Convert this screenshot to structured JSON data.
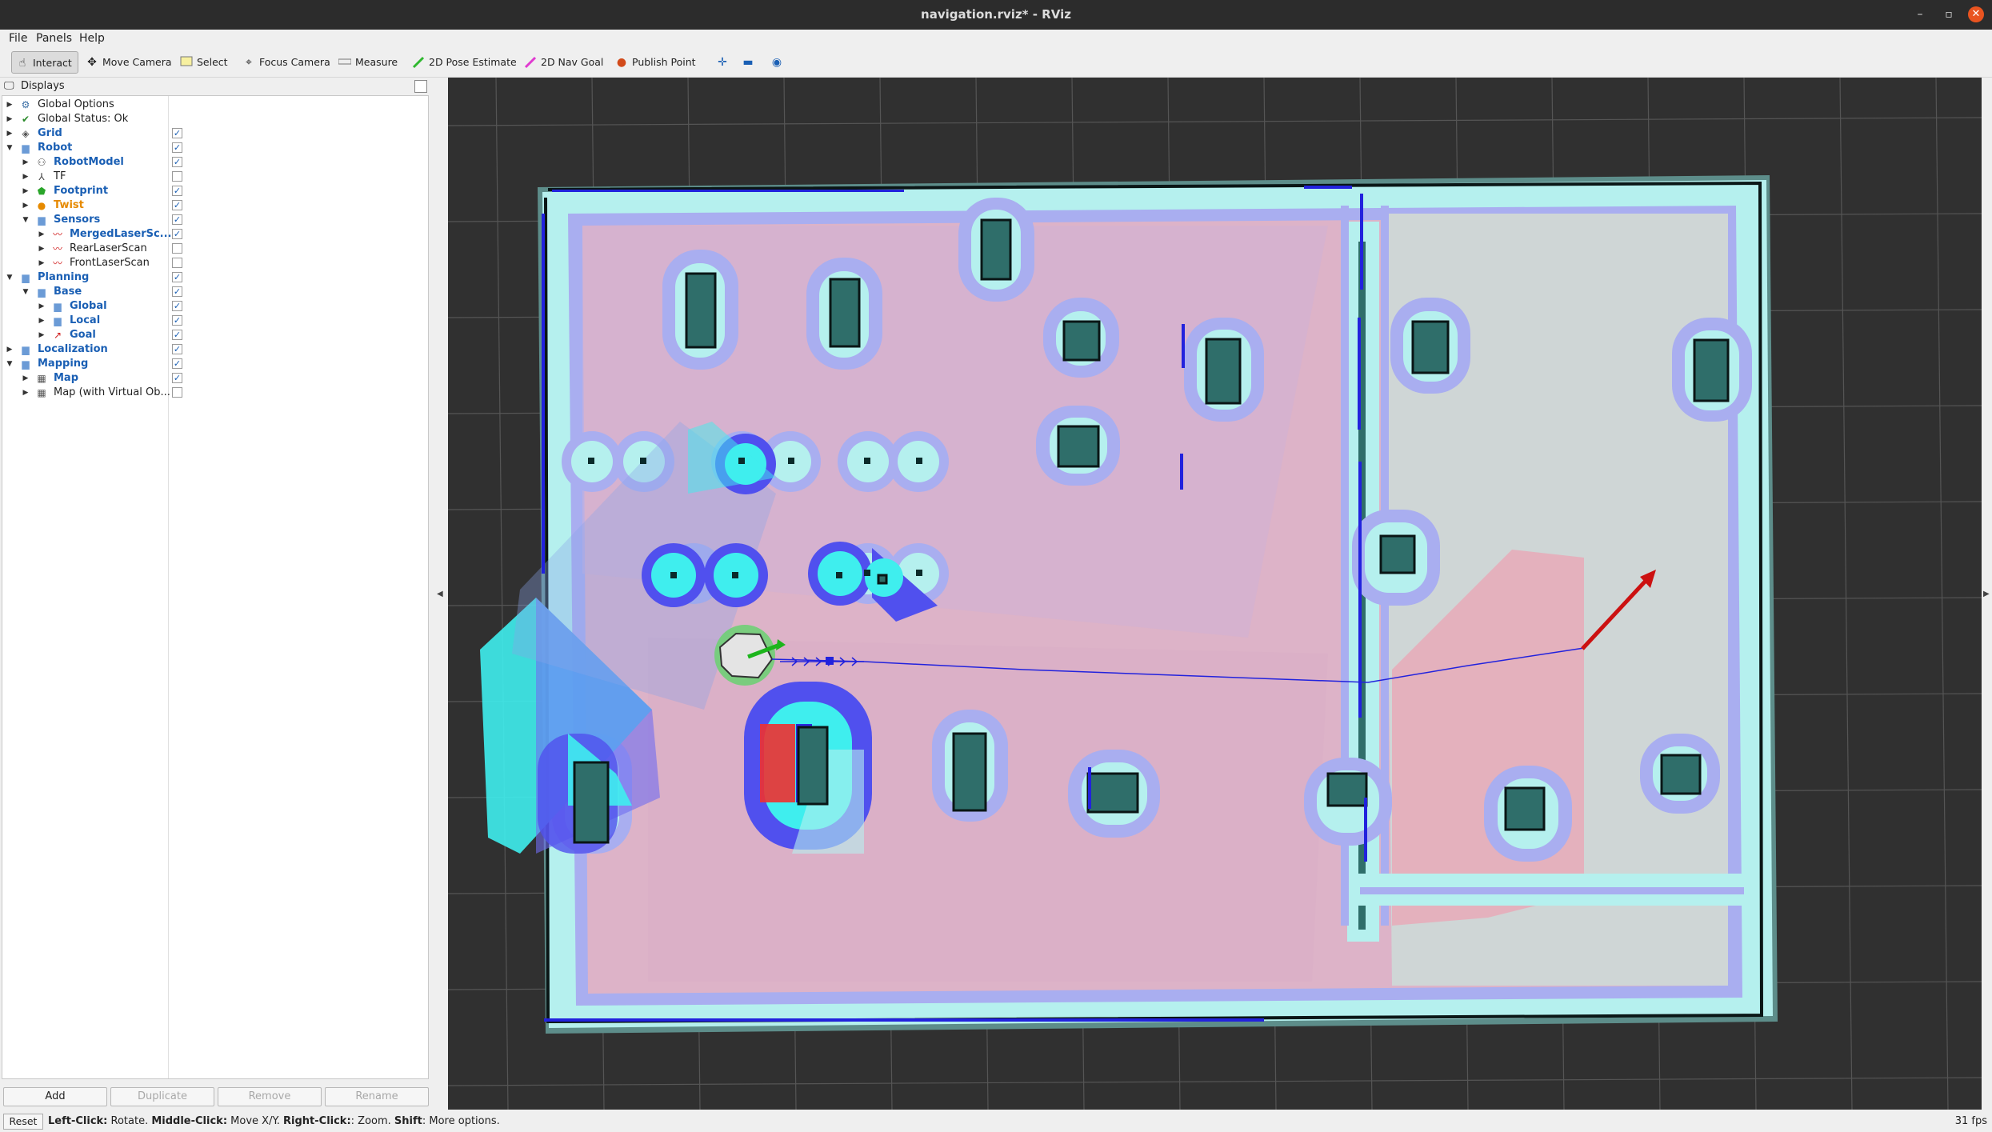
{
  "window": {
    "title": "navigation.rviz* - RViz",
    "controls": {
      "minimize": "–",
      "maximize": "▫",
      "close": "✕"
    }
  },
  "menu": [
    "File",
    "Panels",
    "Help"
  ],
  "toolbar": {
    "tools": [
      {
        "label": "Interact",
        "icon": "hand-icon",
        "active": true
      },
      {
        "label": "Move Camera",
        "icon": "move-camera-icon"
      },
      {
        "label": "Select",
        "icon": "select-icon"
      },
      {
        "label": "Focus Camera",
        "icon": "focus-camera-icon"
      },
      {
        "label": "Measure",
        "icon": "measure-icon"
      },
      {
        "label": "2D Pose Estimate",
        "icon": "pose-estimate-arrow-icon"
      },
      {
        "label": "2D Nav Goal",
        "icon": "nav-goal-arrow-icon"
      },
      {
        "label": "Publish Point",
        "icon": "publish-point-pin-icon"
      }
    ]
  },
  "displays_panel": {
    "title": "Displays",
    "items": [
      {
        "label": "Global Options",
        "icon": "gear-icon",
        "depth": 0,
        "expand": "collapsed",
        "style": "plain",
        "check": null
      },
      {
        "label": "Global Status: Ok",
        "icon": "check-status-icon",
        "depth": 0,
        "expand": "collapsed",
        "style": "plain",
        "check": null
      },
      {
        "label": "Grid",
        "icon": "grid-icon",
        "depth": 0,
        "expand": "collapsed",
        "style": "blue",
        "check": true
      },
      {
        "label": "Robot",
        "icon": "folder-icon",
        "depth": 0,
        "expand": "expanded",
        "style": "blue",
        "check": true
      },
      {
        "label": "RobotModel",
        "icon": "robot-model-icon",
        "depth": 1,
        "expand": "collapsed",
        "style": "blue",
        "check": true
      },
      {
        "label": "TF",
        "icon": "tf-axes-icon",
        "depth": 1,
        "expand": "collapsed",
        "style": "plain",
        "check": false
      },
      {
        "label": "Footprint",
        "icon": "polygon-icon",
        "depth": 1,
        "expand": "collapsed",
        "style": "blue",
        "check": true
      },
      {
        "label": "Twist",
        "icon": "warning-icon",
        "depth": 1,
        "expand": "collapsed",
        "style": "orange",
        "check": true
      },
      {
        "label": "Sensors",
        "icon": "folder-icon",
        "depth": 1,
        "expand": "expanded",
        "style": "blue",
        "check": true
      },
      {
        "label": "MergedLaserSc...",
        "icon": "laser-scan-icon",
        "depth": 2,
        "expand": "collapsed",
        "style": "blue",
        "check": true
      },
      {
        "label": "RearLaserScan",
        "icon": "laser-scan-icon",
        "depth": 2,
        "expand": "collapsed",
        "style": "plain",
        "check": false
      },
      {
        "label": "FrontLaserScan",
        "icon": "laser-scan-icon",
        "depth": 2,
        "expand": "collapsed",
        "style": "plain",
        "check": false
      },
      {
        "label": "Planning",
        "icon": "folder-icon",
        "depth": 0,
        "expand": "expanded",
        "style": "blue",
        "check": true
      },
      {
        "label": "Base",
        "icon": "folder-icon",
        "depth": 1,
        "expand": "expanded",
        "style": "blue",
        "check": true
      },
      {
        "label": "Global",
        "icon": "folder-icon",
        "depth": 2,
        "expand": "collapsed",
        "style": "blue",
        "check": true
      },
      {
        "label": "Local",
        "icon": "folder-icon",
        "depth": 2,
        "expand": "collapsed",
        "style": "blue",
        "check": true
      },
      {
        "label": "Goal",
        "icon": "pose-arrow-icon",
        "depth": 2,
        "expand": "collapsed",
        "style": "blue",
        "check": true
      },
      {
        "label": "Localization",
        "icon": "folder-icon",
        "depth": 0,
        "expand": "collapsed",
        "style": "blue",
        "check": true
      },
      {
        "label": "Mapping",
        "icon": "folder-icon",
        "depth": 0,
        "expand": "expanded",
        "style": "blue",
        "check": true
      },
      {
        "label": "Map",
        "icon": "map-icon",
        "depth": 1,
        "expand": "collapsed",
        "style": "blue",
        "check": true
      },
      {
        "label": "Map (with Virtual Ob...",
        "icon": "map-icon",
        "depth": 1,
        "expand": "collapsed",
        "style": "plain",
        "check": false
      }
    ],
    "buttons": {
      "add": "Add",
      "duplicate": "Duplicate",
      "remove": "Remove",
      "rename": "Rename"
    }
  },
  "status_bar": {
    "reset": "Reset",
    "hint_parts": [
      {
        "text": "Left-Click:",
        "bold": true
      },
      {
        "text": " Rotate. ",
        "bold": false
      },
      {
        "text": "Middle-Click:",
        "bold": true
      },
      {
        "text": " Move X/Y. ",
        "bold": false
      },
      {
        "text": "Right-Click:",
        "bold": true
      },
      {
        "text": ": Zoom. ",
        "bold": false
      },
      {
        "text": "Shift",
        "bold": true
      },
      {
        "text": ": More options.",
        "bold": false
      }
    ],
    "fps": "31 fps"
  },
  "colors": {
    "viewport_bg": "#303030",
    "inflation_cyan": "#b5f0ee",
    "inflation_purple": "#a9aef0",
    "cost_pink": "#e8a8b6",
    "obstacle": "#2f6e6a",
    "path_blue": "#2222dd",
    "goal_red": "#cc1111",
    "link_blue": "#1a5fb4"
  }
}
